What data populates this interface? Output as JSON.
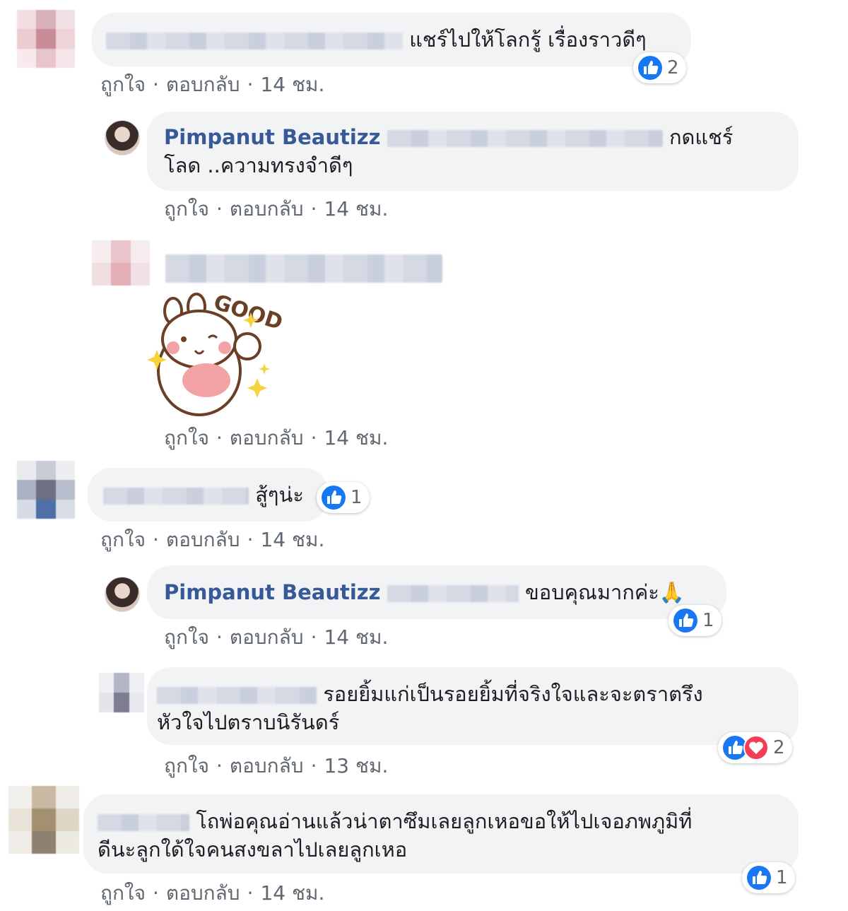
{
  "actions": {
    "like": "ถูกใจ",
    "reply": "ตอบกลับ",
    "separator": "·"
  },
  "comments": [
    {
      "text": "แชร์ไปให้โลกรู้ เรื่องราวดีๆ",
      "time": "14 ชม.",
      "reactions": {
        "icons": [
          "like-icon"
        ],
        "count": "2"
      }
    },
    {
      "author": "Pimpanut Beautizz",
      "text_line1": "กดแชร์",
      "text_line2": "โลด ..ความทรงจำดีๆ",
      "time": "14 ชม."
    },
    {
      "sticker": "GOOD",
      "time": "14 ชม."
    },
    {
      "text": "สู้ๆน่ะ",
      "time": "14 ชม.",
      "reactions": {
        "icons": [
          "like-icon"
        ],
        "count": "1"
      }
    },
    {
      "author": "Pimpanut Beautizz",
      "text": "ขอบคุณมากค่ะ🙏",
      "time": "14 ชม.",
      "reactions": {
        "icons": [
          "like-icon"
        ],
        "count": "1"
      }
    },
    {
      "text_line1": "รอยยิ้มแก่เป็นรอยยิ้มที่จริงใจและจะตราตรึง",
      "text_line2": "หัวใจไปตราบนิรันดร์",
      "time": "13 ชม.",
      "reactions": {
        "icons": [
          "like-icon",
          "love-icon"
        ],
        "count": "2"
      }
    },
    {
      "text_line1": "โถพ่อคุณอ่านแล้วน่าตาซึมเลยลูกเหอขอให้ไปเจอภพภูมิที่",
      "text_line2": "ดีนะลูกใด้ใจคนสงขลาไปเลยลูกเหอ",
      "time": "14 ชม.",
      "reactions": {
        "icons": [
          "like-icon"
        ],
        "count": "1"
      }
    }
  ],
  "colors": {
    "bubble": "#f2f3f5",
    "name": "#385898",
    "like": "#1877f2",
    "love": "#f33e58",
    "meta": "#606770"
  }
}
